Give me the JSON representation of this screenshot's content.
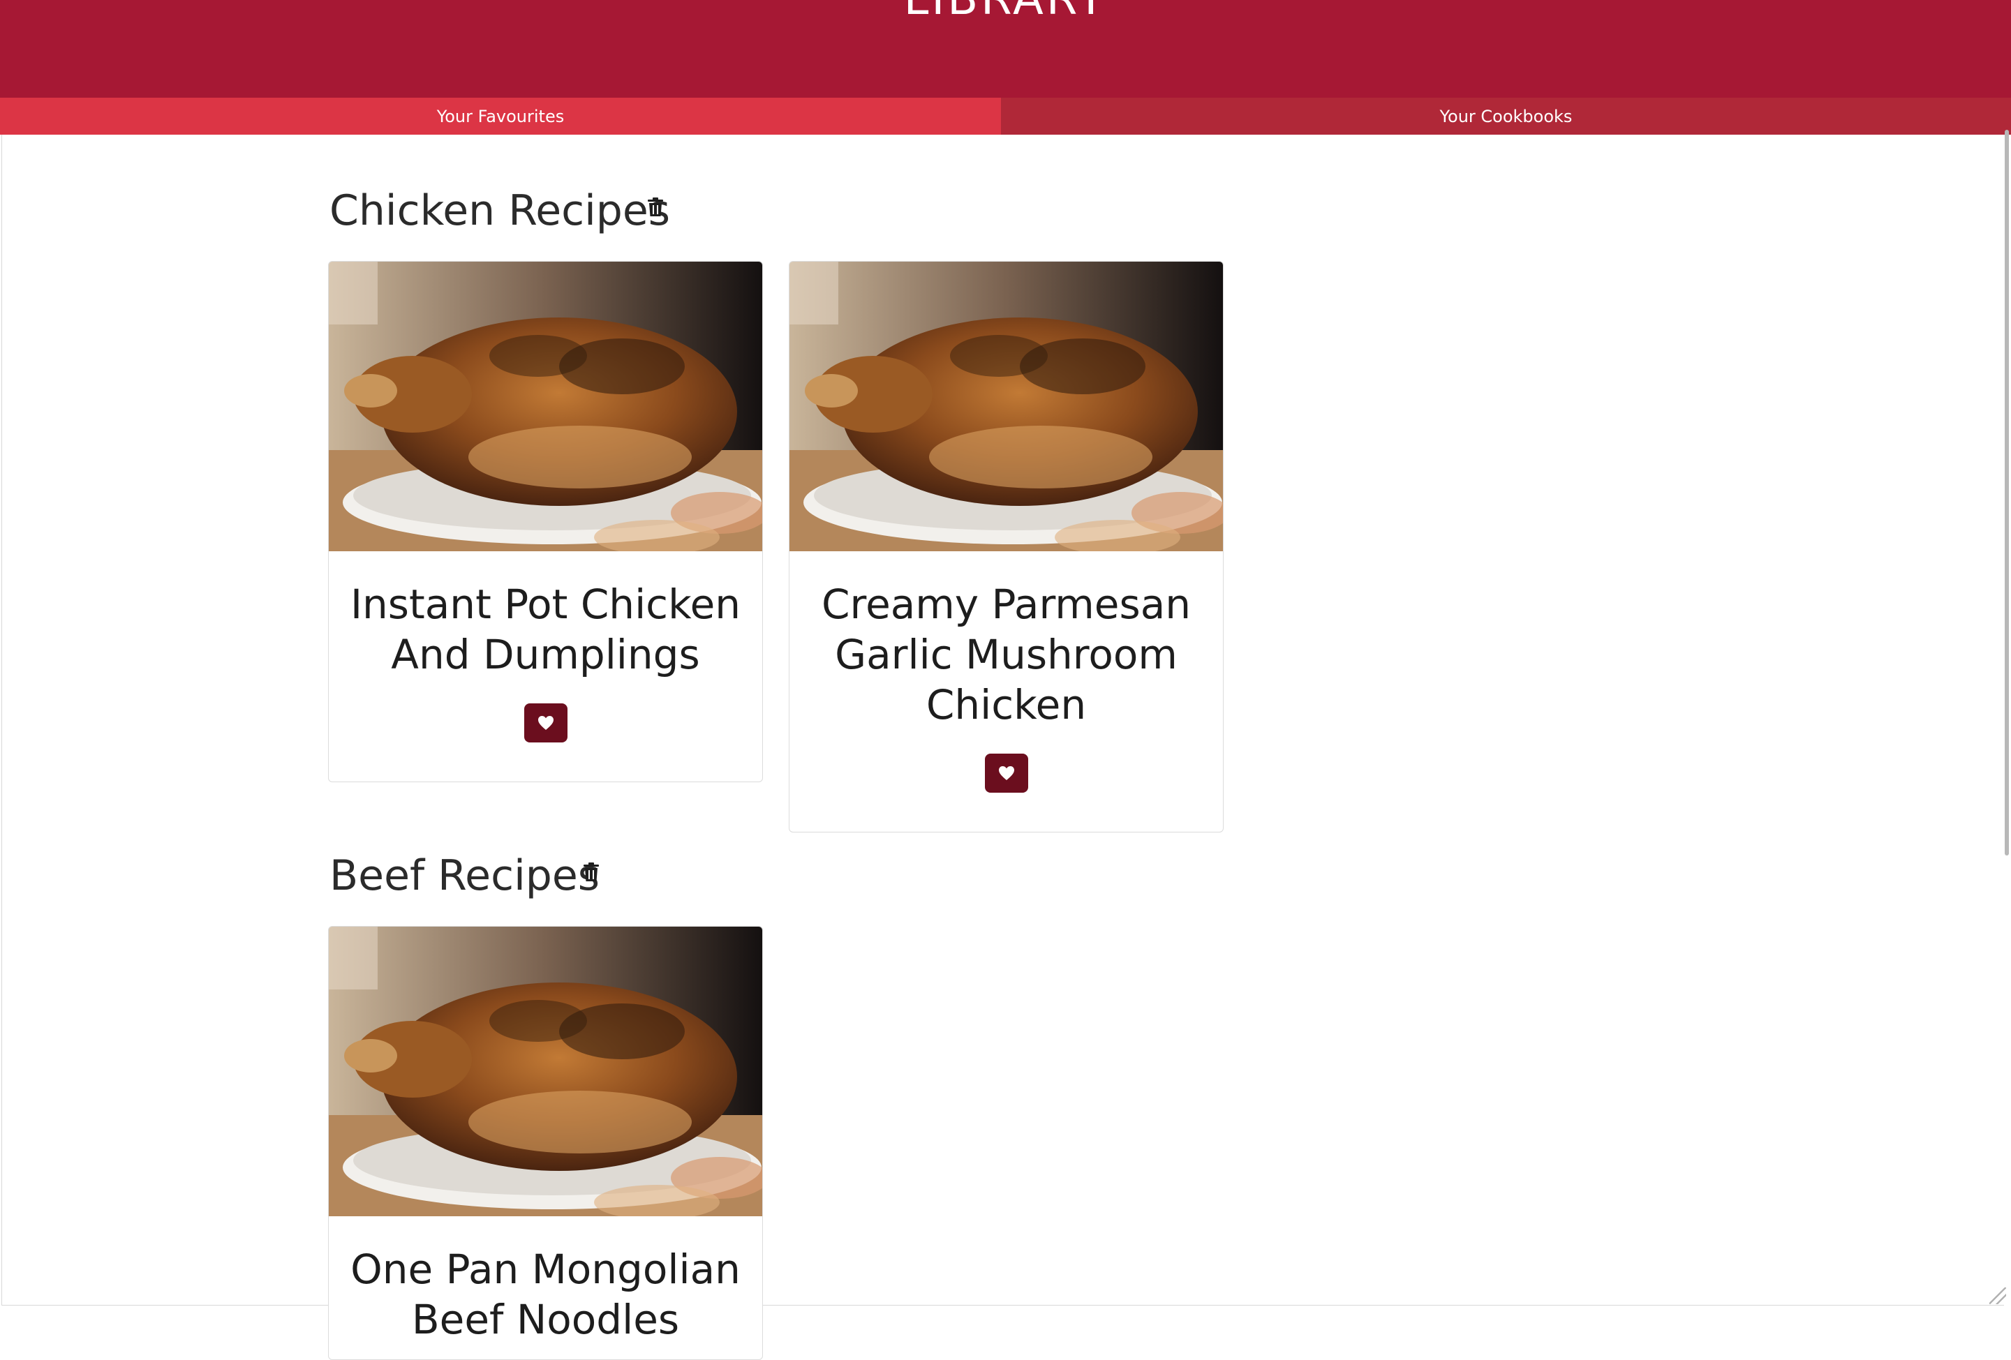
{
  "header": {
    "brand": "LIBRARY"
  },
  "tabs": [
    {
      "label": "Your Favourites",
      "active": true
    },
    {
      "label": "Your Cookbooks",
      "active": false
    }
  ],
  "sections": [
    {
      "title": "Chicken Recipes",
      "recipes": [
        {
          "title": "Instant Pot Chicken And Dumplings"
        },
        {
          "title": "Creamy Parmesan Garlic Mushroom Chicken"
        }
      ]
    },
    {
      "title": "Beef Recipes",
      "recipes": [
        {
          "title": "One Pan Mongolian Beef Noodles"
        }
      ]
    }
  ],
  "icons": {
    "delete": "trash-icon",
    "favourite": "heart-icon"
  },
  "colors": {
    "header": "#a61834",
    "tab_active": "#dc3545",
    "tab_inactive": "#b02838",
    "favourite_button": "#6b0e1e"
  }
}
